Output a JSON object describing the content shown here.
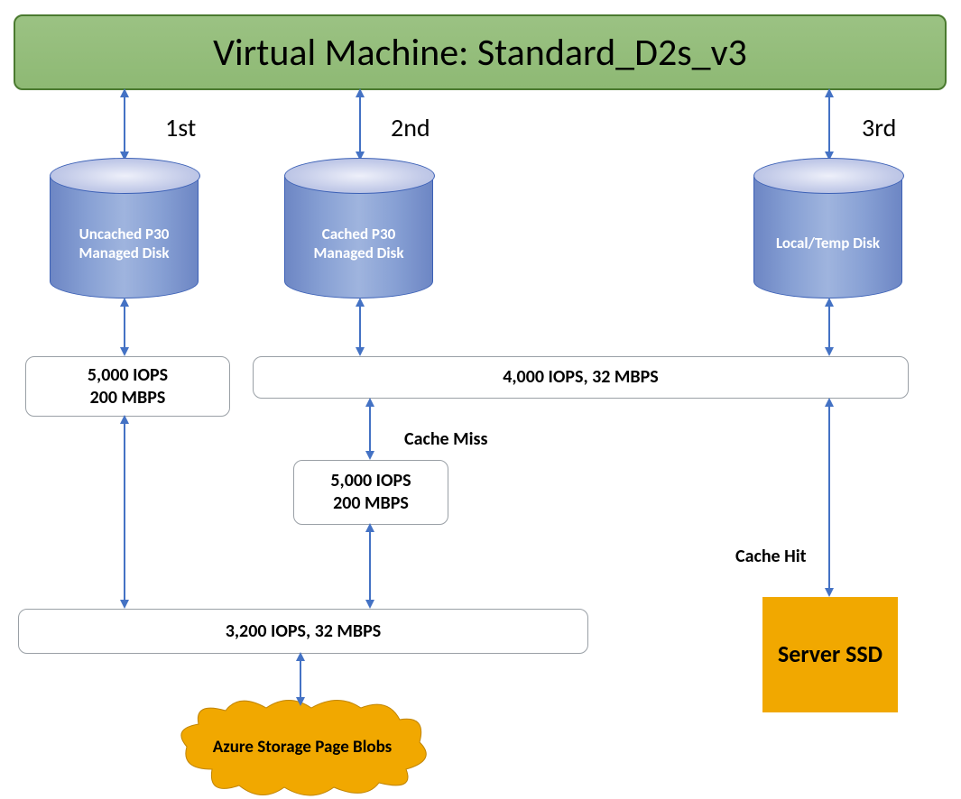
{
  "vm_title": "Virtual Machine: Standard_D2s_v3",
  "ordinals": {
    "first": "1st",
    "second": "2nd",
    "third": "3rd"
  },
  "disks": {
    "uncached": "Uncached P30 Managed Disk",
    "cached": "Cached P30 Managed Disk",
    "local": "Local/Temp Disk"
  },
  "metrics": {
    "uncached_iops": "5,000 IOPS\n200 MBPS",
    "cached_local_iops": "4,000 IOPS, 32 MBPS",
    "cache_miss_iops": "5,000 IOPS\n200 MBPS",
    "page_blobs_iops": "3,200 IOPS, 32 MBPS"
  },
  "labels": {
    "cache_miss": "Cache Miss",
    "cache_hit": "Cache Hit"
  },
  "storage": {
    "page_blobs": "Azure Storage Page Blobs",
    "server_ssd": "Server SSD"
  }
}
